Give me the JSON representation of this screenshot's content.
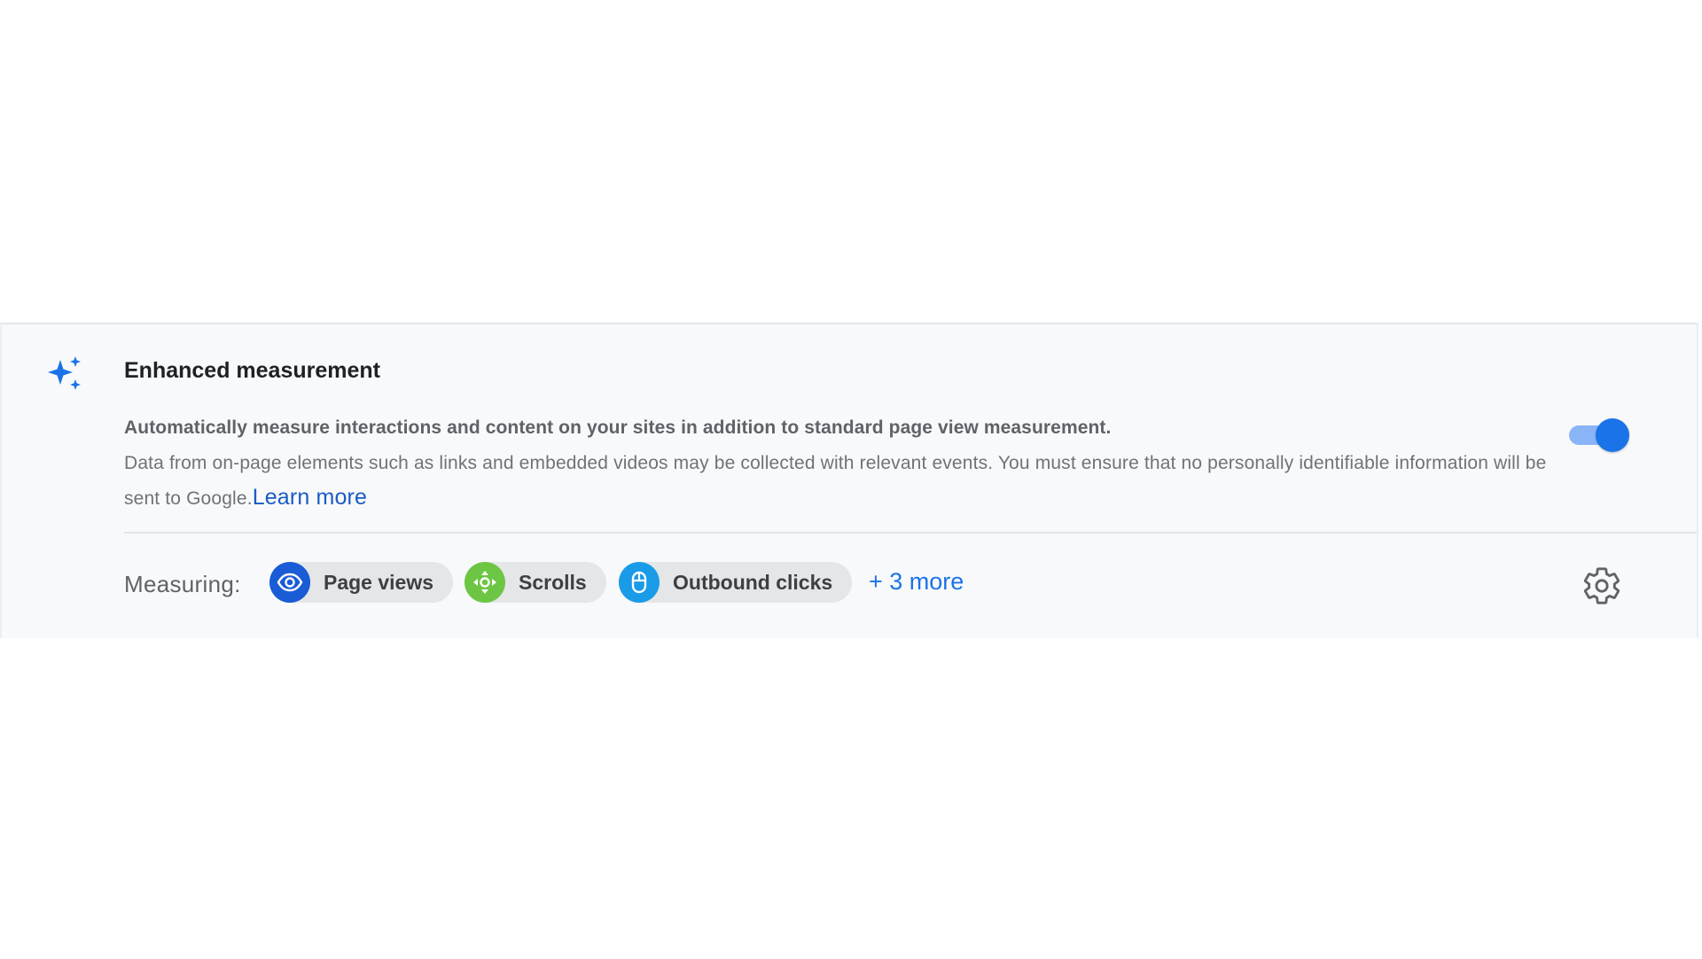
{
  "section": {
    "title": "Enhanced measurement",
    "description_primary": "Automatically measure interactions and content on your sites in addition to standard page view measurement.",
    "description_secondary": "Data from on-page elements such as links and embedded videos may be collected with relevant events. You must ensure that no personally identifiable information will be sent to Google.",
    "learn_more_label": "Learn more",
    "toggle_enabled": true
  },
  "measuring": {
    "label": "Measuring:",
    "chips": [
      {
        "label": "Page views",
        "icon": "eye-icon",
        "color": "#1a5bd6"
      },
      {
        "label": "Scrolls",
        "icon": "scroll-arrows-icon",
        "color": "#6cc644"
      },
      {
        "label": "Outbound clicks",
        "icon": "mouse-icon",
        "color": "#1a9be8"
      }
    ],
    "more_label": "+ 3 more"
  },
  "icons": {
    "header": "sparkle-icon",
    "settings": "gear-icon"
  },
  "colors": {
    "accent": "#1a73e8",
    "link": "#1a5bc4",
    "panel_bg": "#f8f9fa"
  }
}
